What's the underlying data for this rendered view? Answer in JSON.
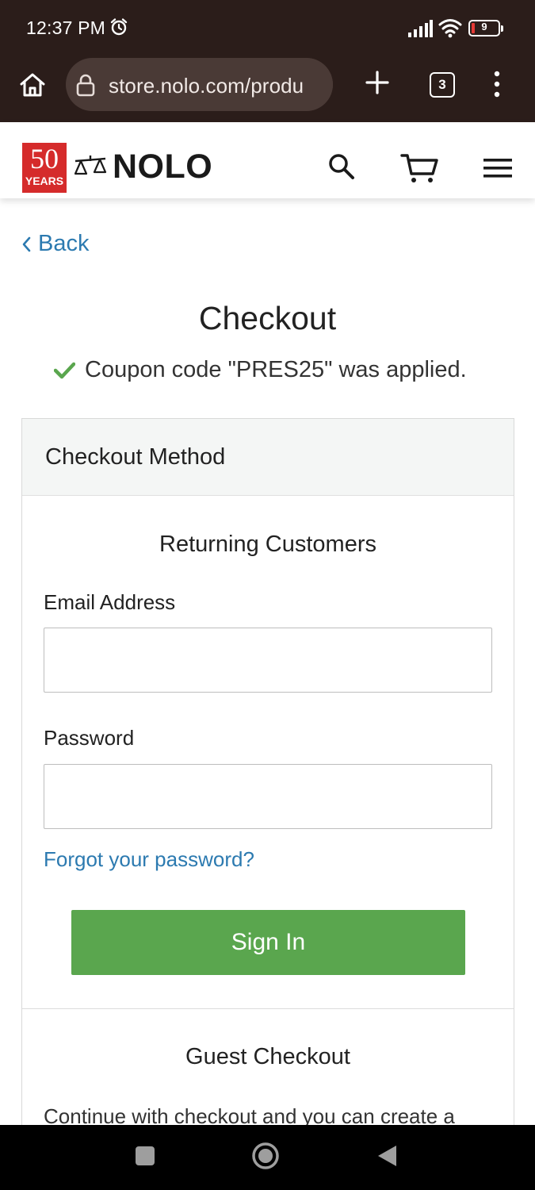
{
  "status_bar": {
    "time": "12:37 PM",
    "battery_level": "9",
    "icons": [
      "alarm-icon",
      "signal-icon",
      "wifi-icon",
      "battery-icon"
    ]
  },
  "browser": {
    "url": "store.nolo.com/produ",
    "tab_count": "3",
    "icons": [
      "home-icon",
      "lock-icon",
      "new-tab-icon",
      "menu-dots-icon"
    ]
  },
  "site_header": {
    "logo_number": "50",
    "logo_years": "YEARS",
    "brand": "NOLO",
    "brand_color": "#d52b2b",
    "icons": [
      "scales-icon",
      "search-icon",
      "cart-icon",
      "hamburger-icon"
    ]
  },
  "page": {
    "back_label": "Back",
    "title": "Checkout",
    "coupon_message": "Coupon code \"PRES25\" was applied.",
    "accent_link_color": "#2c7ab0",
    "success_color": "#5aa64e"
  },
  "checkout_method": {
    "header": "Checkout Method",
    "returning_title": "Returning Customers",
    "email_label": "Email Address",
    "email_value": "",
    "password_label": "Password",
    "password_value": "",
    "forgot_link": "Forgot your password?",
    "sign_in_label": "Sign In",
    "guest_title": "Guest Checkout",
    "guest_text": "Continue with checkout and you can create a"
  },
  "nav_bar": {
    "icons": [
      "recents-square-icon",
      "home-circle-icon",
      "back-triangle-icon"
    ]
  }
}
